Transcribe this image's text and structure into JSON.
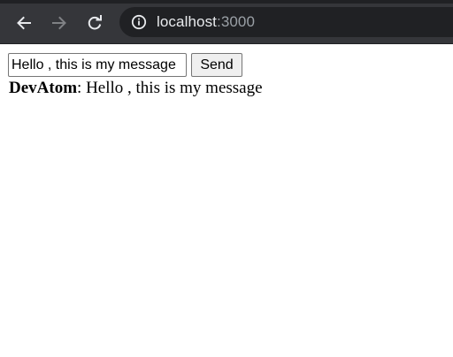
{
  "browser": {
    "url_host": "localhost",
    "url_port": ":3000",
    "icons": {
      "back": "back-arrow-icon",
      "forward": "forward-arrow-icon",
      "reload": "reload-icon",
      "info": "info-icon"
    },
    "colors": {
      "toolbar": "#35363a",
      "omnibox": "#202124",
      "url_host": "#e8eaed",
      "url_port": "#9aa0a6"
    }
  },
  "chat": {
    "input_value": "Hello , this is my message",
    "send_label": "Send",
    "messages": [
      {
        "author": "DevAtom",
        "separator": ": ",
        "text": "Hello , this is my message"
      }
    ]
  }
}
